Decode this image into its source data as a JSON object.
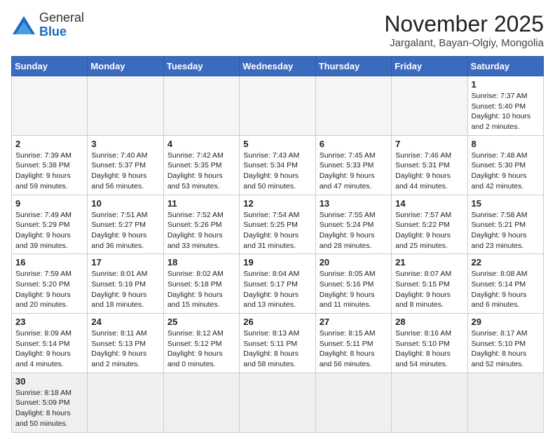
{
  "header": {
    "logo_general": "General",
    "logo_blue": "Blue",
    "month_year": "November 2025",
    "location": "Jargalant, Bayan-Olgiy, Mongolia"
  },
  "weekdays": [
    "Sunday",
    "Monday",
    "Tuesday",
    "Wednesday",
    "Thursday",
    "Friday",
    "Saturday"
  ],
  "weeks": [
    [
      {
        "day": "",
        "info": ""
      },
      {
        "day": "",
        "info": ""
      },
      {
        "day": "",
        "info": ""
      },
      {
        "day": "",
        "info": ""
      },
      {
        "day": "",
        "info": ""
      },
      {
        "day": "",
        "info": ""
      },
      {
        "day": "1",
        "info": "Sunrise: 7:37 AM\nSunset: 5:40 PM\nDaylight: 10 hours and 2 minutes."
      }
    ],
    [
      {
        "day": "2",
        "info": "Sunrise: 7:39 AM\nSunset: 5:38 PM\nDaylight: 9 hours and 59 minutes."
      },
      {
        "day": "3",
        "info": "Sunrise: 7:40 AM\nSunset: 5:37 PM\nDaylight: 9 hours and 56 minutes."
      },
      {
        "day": "4",
        "info": "Sunrise: 7:42 AM\nSunset: 5:35 PM\nDaylight: 9 hours and 53 minutes."
      },
      {
        "day": "5",
        "info": "Sunrise: 7:43 AM\nSunset: 5:34 PM\nDaylight: 9 hours and 50 minutes."
      },
      {
        "day": "6",
        "info": "Sunrise: 7:45 AM\nSunset: 5:33 PM\nDaylight: 9 hours and 47 minutes."
      },
      {
        "day": "7",
        "info": "Sunrise: 7:46 AM\nSunset: 5:31 PM\nDaylight: 9 hours and 44 minutes."
      },
      {
        "day": "8",
        "info": "Sunrise: 7:48 AM\nSunset: 5:30 PM\nDaylight: 9 hours and 42 minutes."
      }
    ],
    [
      {
        "day": "9",
        "info": "Sunrise: 7:49 AM\nSunset: 5:29 PM\nDaylight: 9 hours and 39 minutes."
      },
      {
        "day": "10",
        "info": "Sunrise: 7:51 AM\nSunset: 5:27 PM\nDaylight: 9 hours and 36 minutes."
      },
      {
        "day": "11",
        "info": "Sunrise: 7:52 AM\nSunset: 5:26 PM\nDaylight: 9 hours and 33 minutes."
      },
      {
        "day": "12",
        "info": "Sunrise: 7:54 AM\nSunset: 5:25 PM\nDaylight: 9 hours and 31 minutes."
      },
      {
        "day": "13",
        "info": "Sunrise: 7:55 AM\nSunset: 5:24 PM\nDaylight: 9 hours and 28 minutes."
      },
      {
        "day": "14",
        "info": "Sunrise: 7:57 AM\nSunset: 5:22 PM\nDaylight: 9 hours and 25 minutes."
      },
      {
        "day": "15",
        "info": "Sunrise: 7:58 AM\nSunset: 5:21 PM\nDaylight: 9 hours and 23 minutes."
      }
    ],
    [
      {
        "day": "16",
        "info": "Sunrise: 7:59 AM\nSunset: 5:20 PM\nDaylight: 9 hours and 20 minutes."
      },
      {
        "day": "17",
        "info": "Sunrise: 8:01 AM\nSunset: 5:19 PM\nDaylight: 9 hours and 18 minutes."
      },
      {
        "day": "18",
        "info": "Sunrise: 8:02 AM\nSunset: 5:18 PM\nDaylight: 9 hours and 15 minutes."
      },
      {
        "day": "19",
        "info": "Sunrise: 8:04 AM\nSunset: 5:17 PM\nDaylight: 9 hours and 13 minutes."
      },
      {
        "day": "20",
        "info": "Sunrise: 8:05 AM\nSunset: 5:16 PM\nDaylight: 9 hours and 11 minutes."
      },
      {
        "day": "21",
        "info": "Sunrise: 8:07 AM\nSunset: 5:15 PM\nDaylight: 9 hours and 8 minutes."
      },
      {
        "day": "22",
        "info": "Sunrise: 8:08 AM\nSunset: 5:14 PM\nDaylight: 9 hours and 6 minutes."
      }
    ],
    [
      {
        "day": "23",
        "info": "Sunrise: 8:09 AM\nSunset: 5:14 PM\nDaylight: 9 hours and 4 minutes."
      },
      {
        "day": "24",
        "info": "Sunrise: 8:11 AM\nSunset: 5:13 PM\nDaylight: 9 hours and 2 minutes."
      },
      {
        "day": "25",
        "info": "Sunrise: 8:12 AM\nSunset: 5:12 PM\nDaylight: 9 hours and 0 minutes."
      },
      {
        "day": "26",
        "info": "Sunrise: 8:13 AM\nSunset: 5:11 PM\nDaylight: 8 hours and 58 minutes."
      },
      {
        "day": "27",
        "info": "Sunrise: 8:15 AM\nSunset: 5:11 PM\nDaylight: 8 hours and 56 minutes."
      },
      {
        "day": "28",
        "info": "Sunrise: 8:16 AM\nSunset: 5:10 PM\nDaylight: 8 hours and 54 minutes."
      },
      {
        "day": "29",
        "info": "Sunrise: 8:17 AM\nSunset: 5:10 PM\nDaylight: 8 hours and 52 minutes."
      }
    ],
    [
      {
        "day": "30",
        "info": "Sunrise: 8:18 AM\nSunset: 5:09 PM\nDaylight: 8 hours and 50 minutes."
      },
      {
        "day": "",
        "info": ""
      },
      {
        "day": "",
        "info": ""
      },
      {
        "day": "",
        "info": ""
      },
      {
        "day": "",
        "info": ""
      },
      {
        "day": "",
        "info": ""
      },
      {
        "day": "",
        "info": ""
      }
    ]
  ]
}
